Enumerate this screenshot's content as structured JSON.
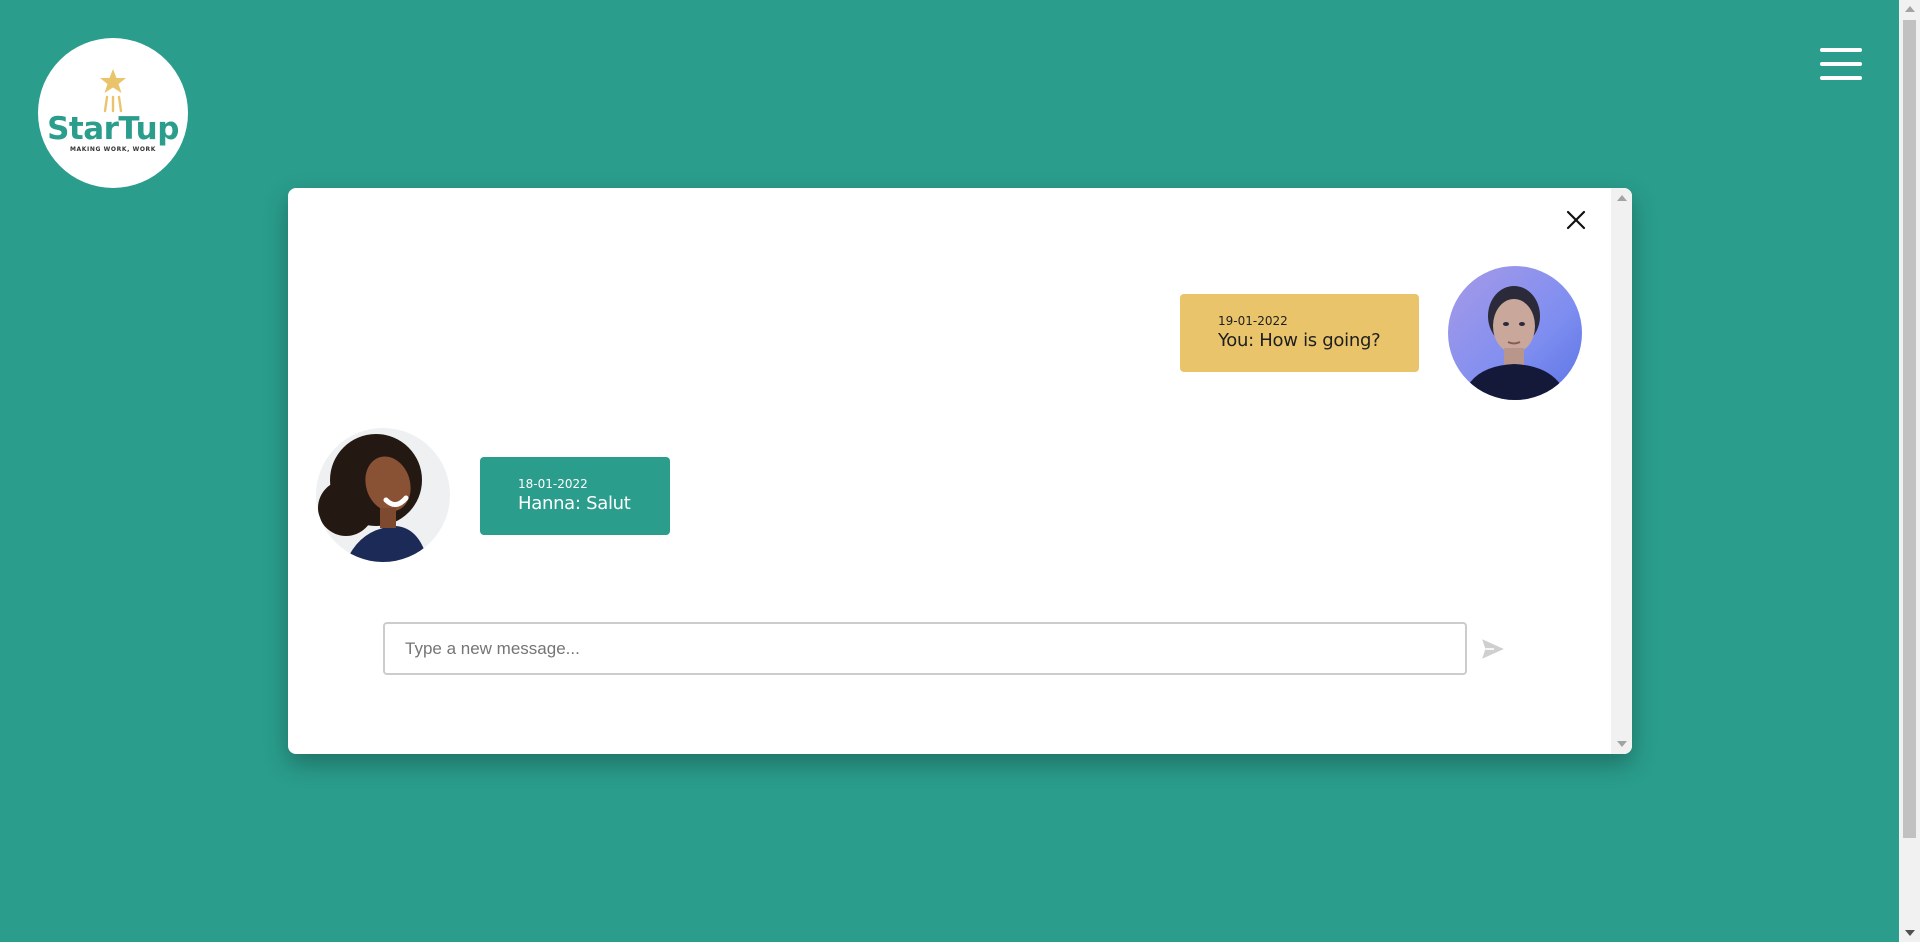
{
  "logo": {
    "name": "StarTup",
    "tagline": "MAKING WORK, WORK"
  },
  "header": {
    "menu_icon": "hamburger-menu-icon"
  },
  "chat": {
    "close_icon": "close-icon",
    "messages": [
      {
        "sender": "you",
        "date": "19-01-2022",
        "text": "You: How is going?"
      },
      {
        "sender": "hanna",
        "date": "18-01-2022",
        "text": "Hanna: Salut"
      }
    ],
    "input": {
      "placeholder": "Type a new message...",
      "value": ""
    },
    "send_icon": "send-icon"
  },
  "colors": {
    "background": "#2a9d8c",
    "accent_yellow": "#e9c46a",
    "accent_teal": "#2a9d8c",
    "modal": "#ffffff"
  }
}
